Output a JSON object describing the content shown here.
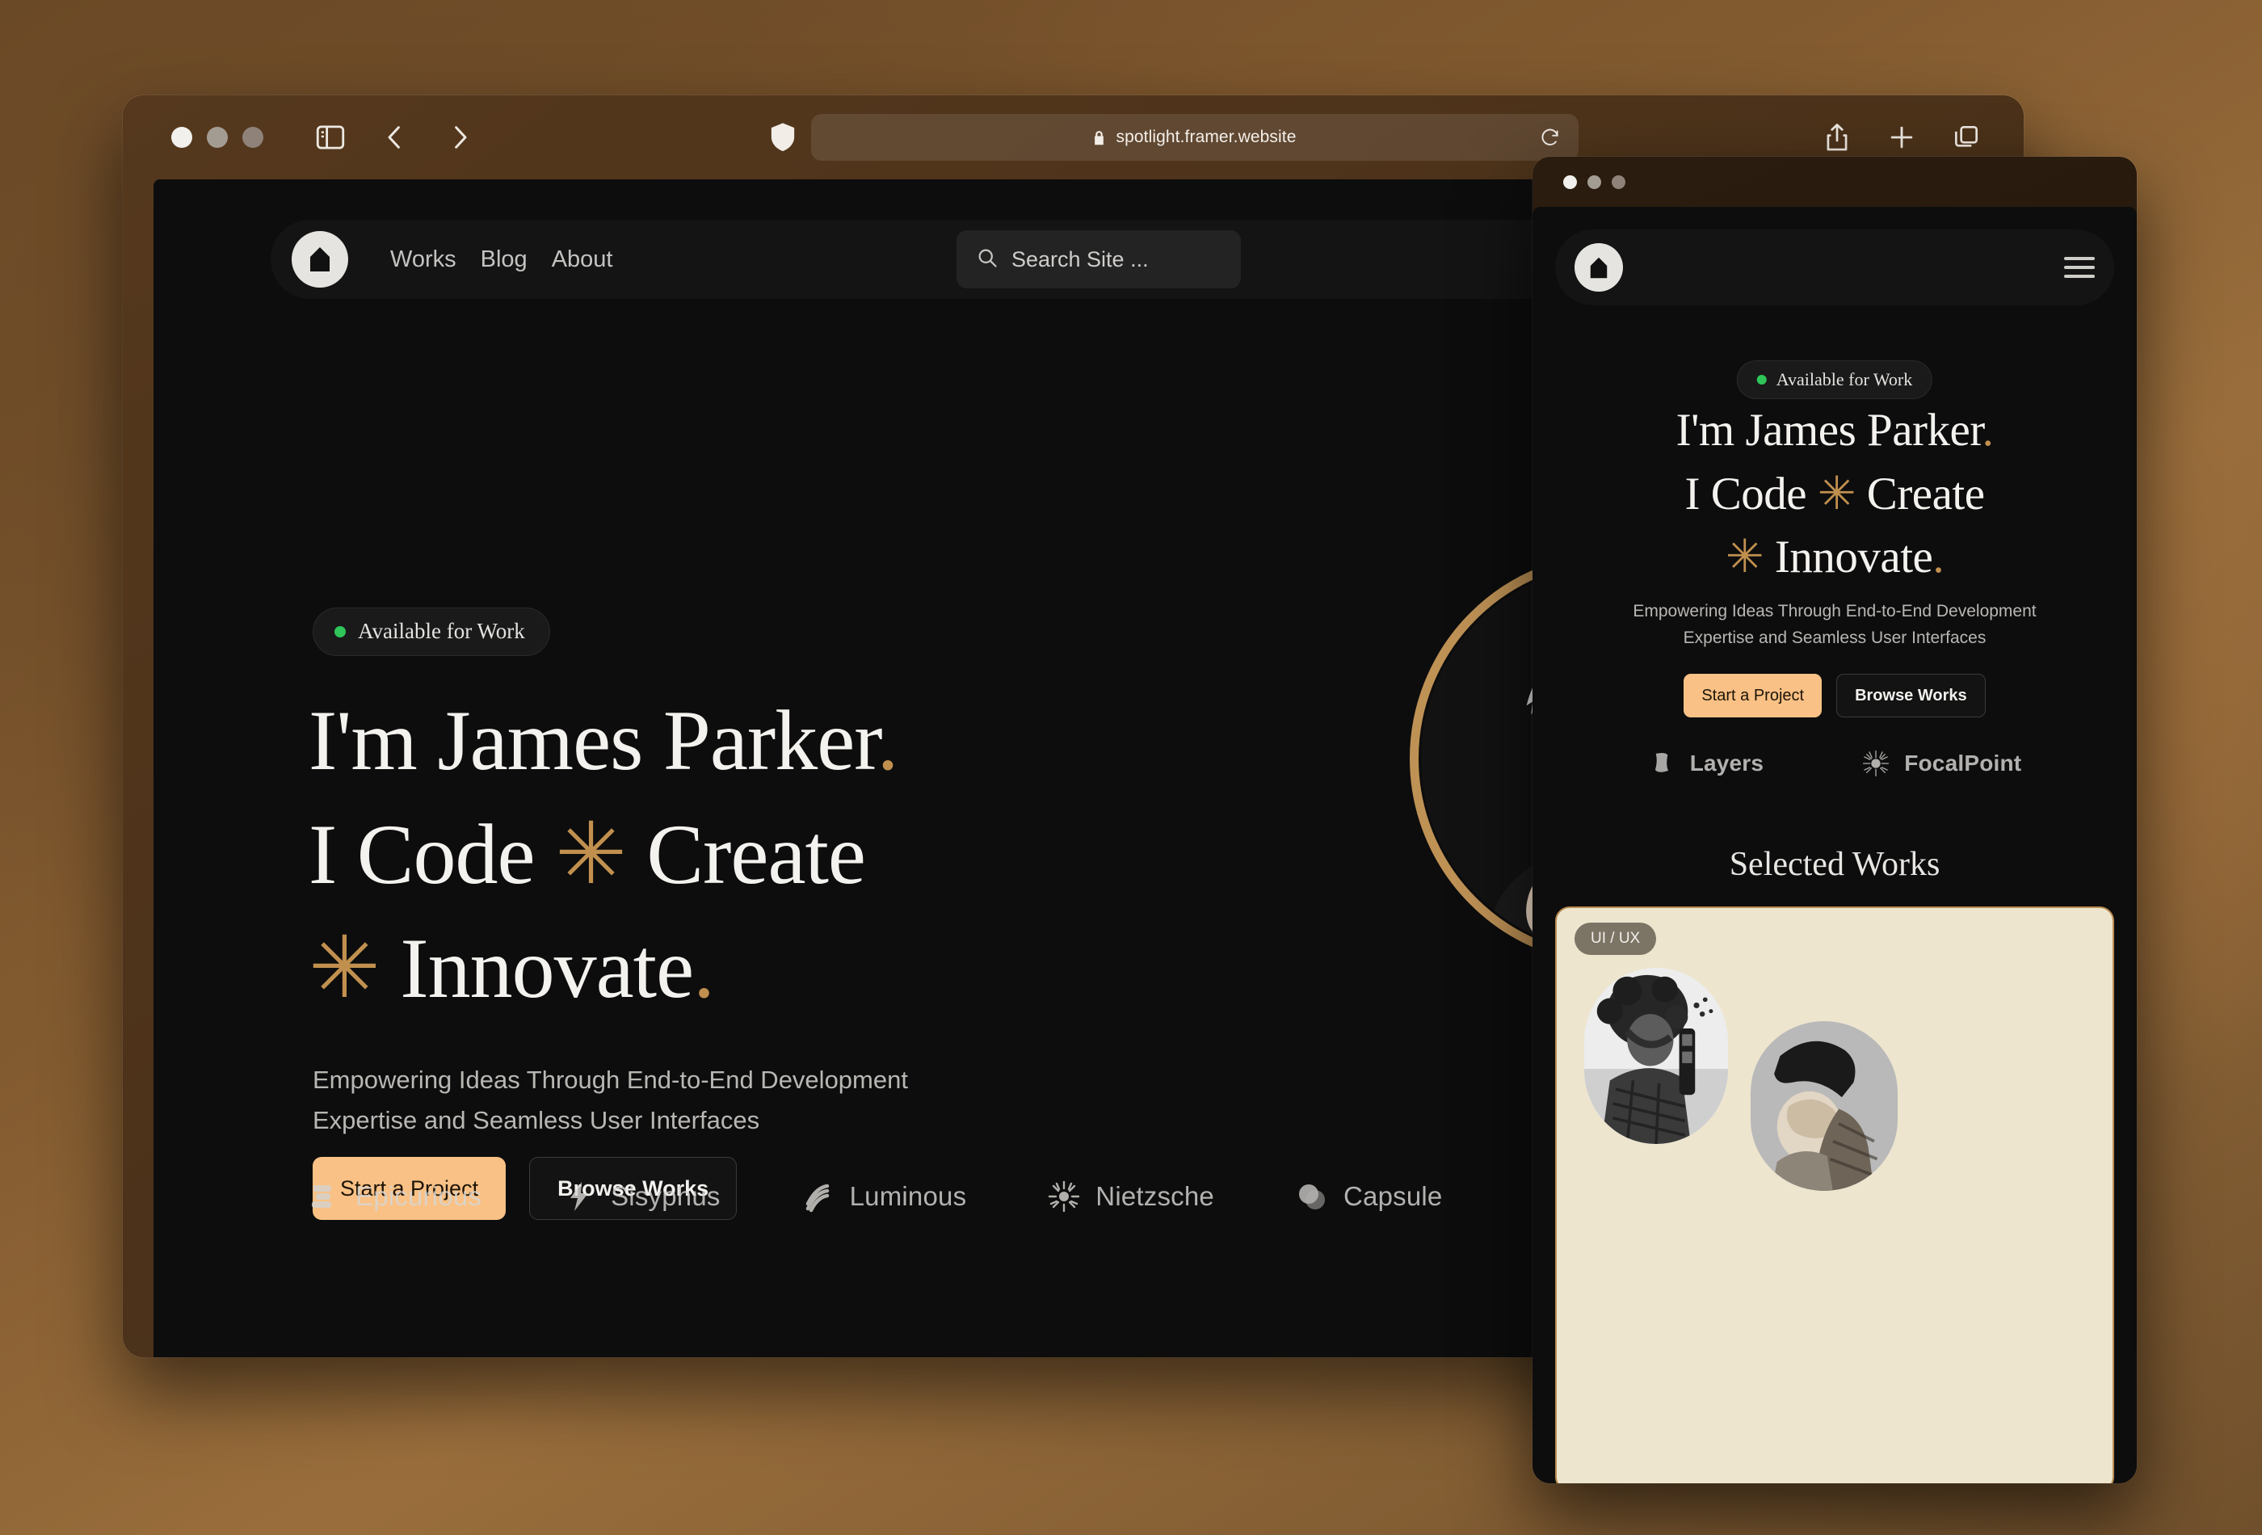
{
  "browser": {
    "url": "spotlight.framer.website",
    "icons": {
      "sidebar": "sidebar-icon",
      "back": "back-chevron-icon",
      "forward": "forward-chevron-icon",
      "shield": "shield-icon",
      "lock": "lock-icon",
      "reload": "reload-icon",
      "share": "share-icon",
      "new_tab": "plus-icon",
      "tabs": "tab-overview-icon"
    }
  },
  "site": {
    "nav": {
      "logo": "home-logo-icon",
      "links": [
        "Works",
        "Blog",
        "About"
      ],
      "search_placeholder": "Search Site ...",
      "socials": [
        "x-icon",
        "github-icon"
      ]
    },
    "hero": {
      "badge": "Available for Work",
      "badge_dot_color": "#2FC559",
      "headline_lines": [
        {
          "text": "I'm James Parker",
          "suffix": ".",
          "prefix": ""
        },
        {
          "text": "I Code ",
          "mid": "✳",
          "rest": " Create"
        },
        {
          "prefix": "✳",
          "text": " Innovate",
          "suffix": "."
        }
      ],
      "headline_plain": "I'm James Parker. I Code ✳ Create ✳ Innovate.",
      "subtitle_line1": "Empowering Ideas Through End-to-End Development",
      "subtitle_line2": "Expertise and Seamless User Interfaces",
      "cta_primary": "Start a Project",
      "cta_secondary": "Browse Works",
      "accent_color": "#C1904F",
      "primary_button_color": "#F9C185",
      "avatar": "memoji-avatar",
      "avatar_ring_color": "#BE9155",
      "avatar_socials": [
        "x-icon",
        "github-icon"
      ]
    },
    "brands": [
      {
        "name": "Epicurious",
        "icon": "epicurious-logo-icon"
      },
      {
        "name": "Sisyphus",
        "icon": "sisyphus-bolt-logo-icon"
      },
      {
        "name": "Luminous",
        "icon": "luminous-waves-logo-icon"
      },
      {
        "name": "Nietzsche",
        "icon": "nietzsche-sunburst-logo-icon"
      },
      {
        "name": "Capsule",
        "icon": "capsule-circles-logo-icon"
      }
    ]
  },
  "mobile": {
    "nav": {
      "logo": "home-logo-icon",
      "menu": "hamburger-menu-icon"
    },
    "hero": {
      "badge": "Available for Work",
      "line1": "I'm James Parker",
      "line1_dot": ".",
      "line2a": "I Code ",
      "line2_star": "✳",
      "line2b": " Create",
      "line3_star": "✳",
      "line3": " Innovate",
      "line3_dot": ".",
      "subtitle_line1": "Empowering Ideas Through End-to-End Development",
      "subtitle_line2": "Expertise and Seamless User Interfaces",
      "cta_primary": "Start a Project",
      "cta_secondary": "Browse Works"
    },
    "brands": [
      {
        "name": "Layers",
        "icon": "layers-logo-icon"
      },
      {
        "name": "FocalPoint",
        "icon": "focalpoint-sunburst-logo-icon"
      }
    ],
    "works": {
      "title": "Selected Works",
      "card_tag": "UI / UX",
      "card_bg": "#EDE5CE"
    }
  }
}
